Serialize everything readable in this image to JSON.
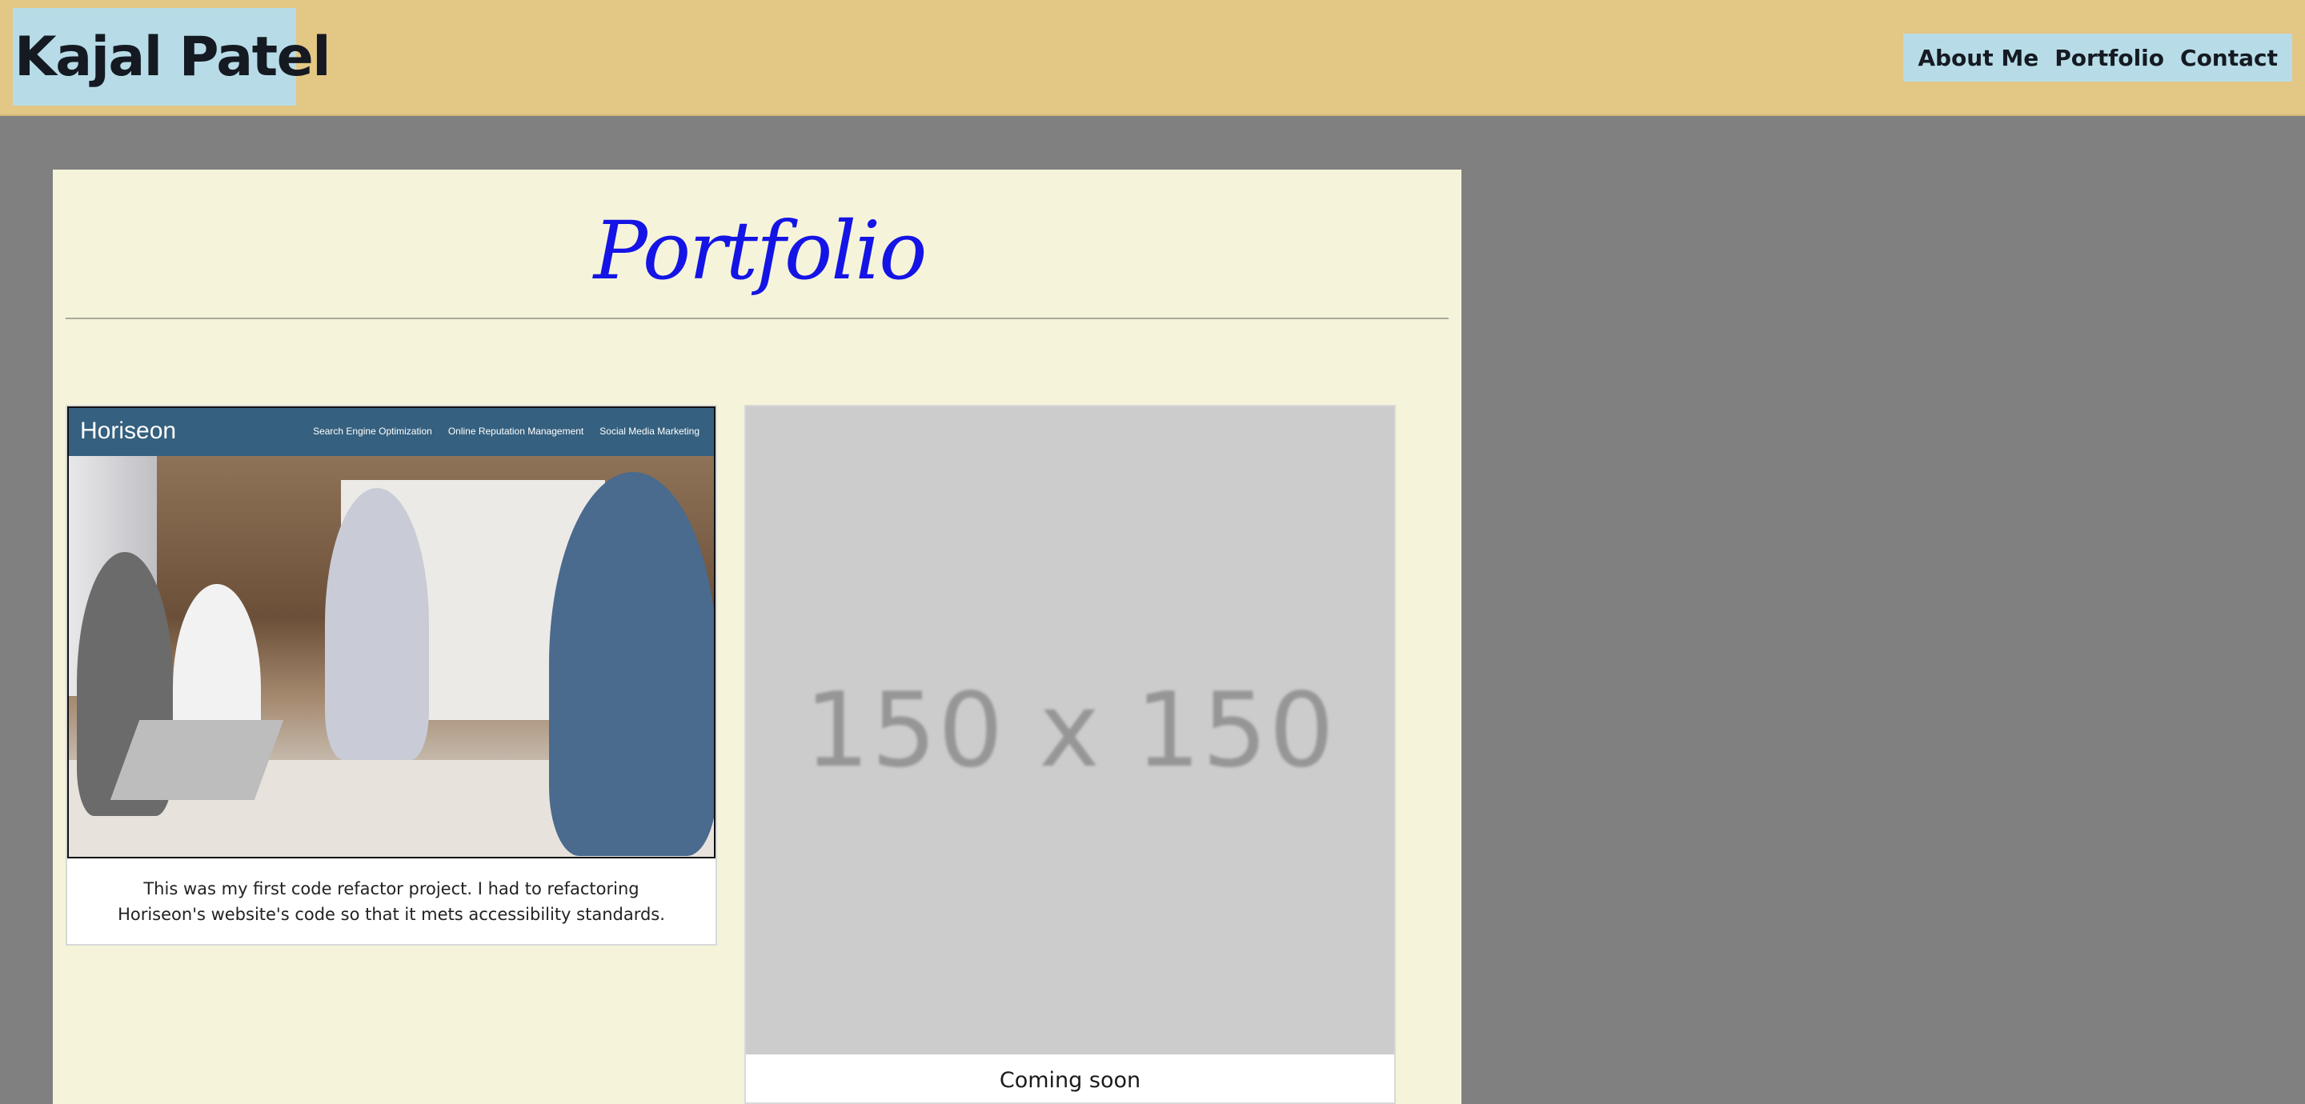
{
  "header": {
    "brand": "Kajal Patel",
    "nav": [
      "About Me",
      "Portfolio",
      "Contact"
    ]
  },
  "main": {
    "title": "Portfolio",
    "projects": [
      {
        "screenshot": {
          "logo": "Horiseon",
          "links": [
            "Search Engine Optimization",
            "Online Reputation Management",
            "Social Media Marketing"
          ]
        },
        "description": "This was my first code refactor project. I had to refactoring Horiseon's website's code so that it mets accessibility standards."
      },
      {
        "placeholder": "150 x 150",
        "caption": "Coming soon"
      }
    ]
  },
  "colors": {
    "header_bg": "#e3c784",
    "nav_bg": "#b7dce7",
    "page_bg": "#808080",
    "panel_bg": "#f5f4da",
    "title": "#1414e6"
  }
}
